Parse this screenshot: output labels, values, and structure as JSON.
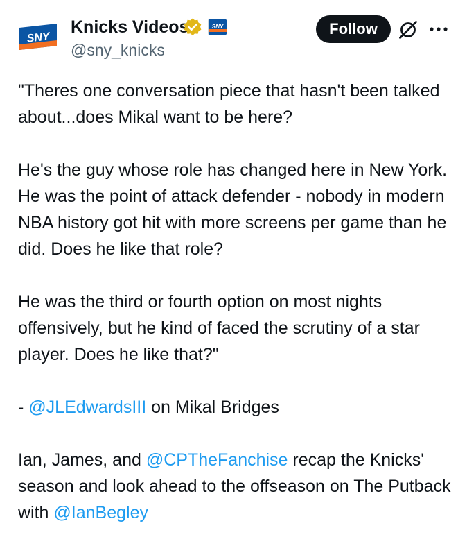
{
  "author": {
    "display_name": "Knicks Videos",
    "handle": "@sny_knicks",
    "avatar_text": "SNY",
    "affiliate_badge_text": "SNY",
    "verified_icon": "gold-verified-badge-icon"
  },
  "actions": {
    "follow_label": "Follow",
    "grok_icon": "grok-icon",
    "more_icon": "more-options-icon"
  },
  "colors": {
    "text": "#0f1419",
    "secondary_text": "#536471",
    "link": "#1d9bf0",
    "follow_bg": "#0f1419",
    "verified_gold": "#e2b719",
    "sny_blue": "#0b55a4",
    "sny_orange": "#f26f21"
  },
  "tweet": {
    "p1": "\"Theres one conversation piece that hasn't been talked about...does Mikal want to be here?",
    "p2": "He's the guy whose role has changed here in New York. He was the point of attack defender - nobody in modern NBA history got hit with more screens per game than he did. Does he like that role?",
    "p3": "He was the third or fourth option on most nights offensively, but he kind of faced the scrutiny of a star player. Does he like that?\"",
    "p4_prefix": "- ",
    "p4_mention": "@JLEdwardsIII",
    "p4_suffix": " on Mikal Bridges",
    "p5_a": "Ian, James, and ",
    "p5_mention1": "@CPTheFanchise",
    "p5_b": " recap the Knicks' season and look ahead to the offseason on The Putback with ",
    "p5_mention2": "@IanBegley"
  }
}
